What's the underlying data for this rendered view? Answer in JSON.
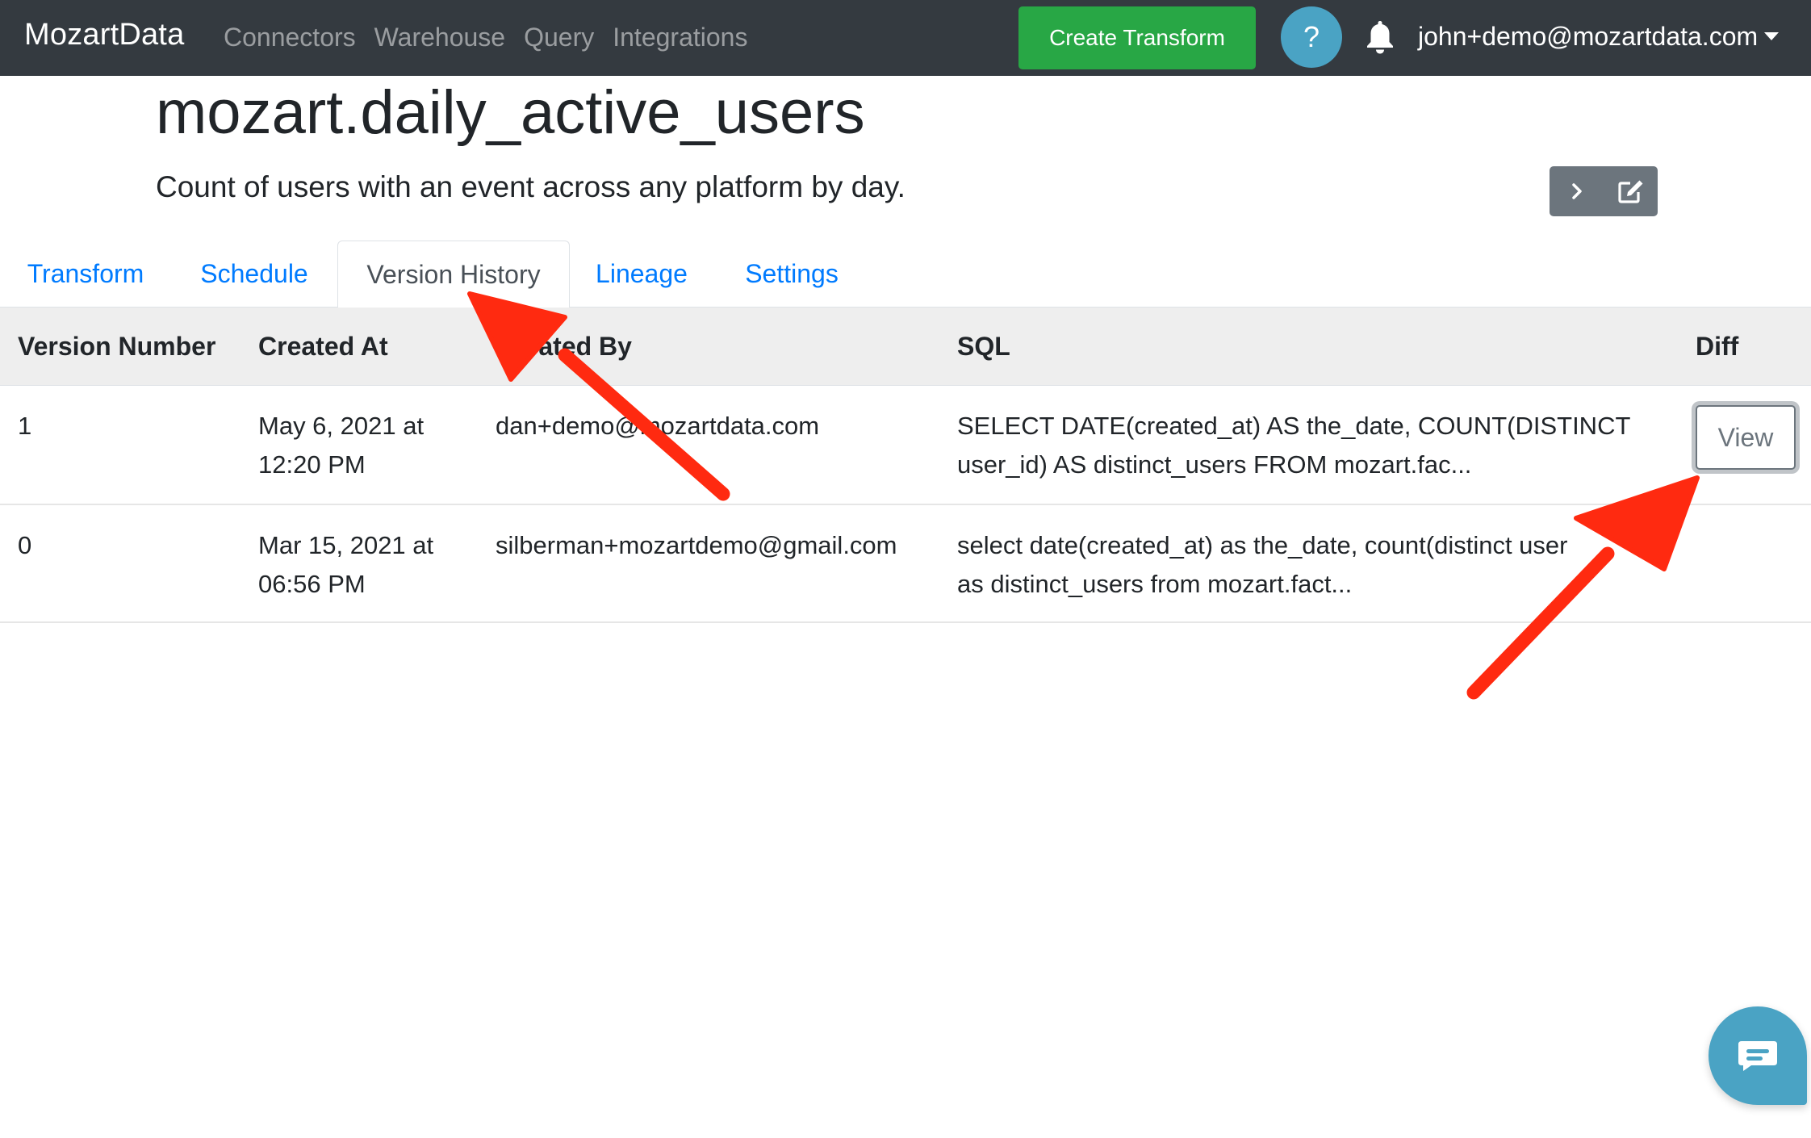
{
  "navbar": {
    "brand": "MozartData",
    "links": [
      "Connectors",
      "Warehouse",
      "Query",
      "Integrations"
    ],
    "create_button": "Create Transform",
    "help_button": "?",
    "user_email": "john+demo@mozartdata.com"
  },
  "header": {
    "title": "mozart.daily_active_users",
    "subtitle": "Count of users with an event across any platform by day."
  },
  "tabs": [
    {
      "label": "Transform",
      "active": false
    },
    {
      "label": "Schedule",
      "active": false
    },
    {
      "label": "Version History",
      "active": true
    },
    {
      "label": "Lineage",
      "active": false
    },
    {
      "label": "Settings",
      "active": false
    }
  ],
  "table": {
    "columns": [
      "Version Number",
      "Created At",
      "Created By",
      "SQL",
      "Diff"
    ],
    "rows": [
      {
        "version": "1",
        "created_at_date": "May 6, 2021 at",
        "created_at_time": "12:20 PM",
        "created_by": "dan+demo@mozartdata.com",
        "sql_line1": "SELECT DATE(created_at) AS the_date, COUNT(DISTINCT",
        "sql_line2": "user_id) AS distinct_users FROM mozart.fac...",
        "diff_button": "View"
      },
      {
        "version": "0",
        "created_at_date": "Mar 15, 2021 at",
        "created_at_time": "06:56 PM",
        "created_by": "silberman+mozartdemo@gmail.com",
        "sql_line1": "select date(created_at) as the_date, count(distinct user",
        "sql_line2": "as distinct_users from mozart.fact...",
        "diff_button": ""
      }
    ]
  },
  "colors": {
    "navbar_bg": "#343a40",
    "accent_link": "#007bff",
    "create_button": "#28a745",
    "help_button": "#4aa3c4",
    "annotation_arrow": "#ff2a10"
  },
  "icons": [
    "bell-icon",
    "chevron-right-icon",
    "edit-icon",
    "chat-icon",
    "caret-down-icon"
  ]
}
